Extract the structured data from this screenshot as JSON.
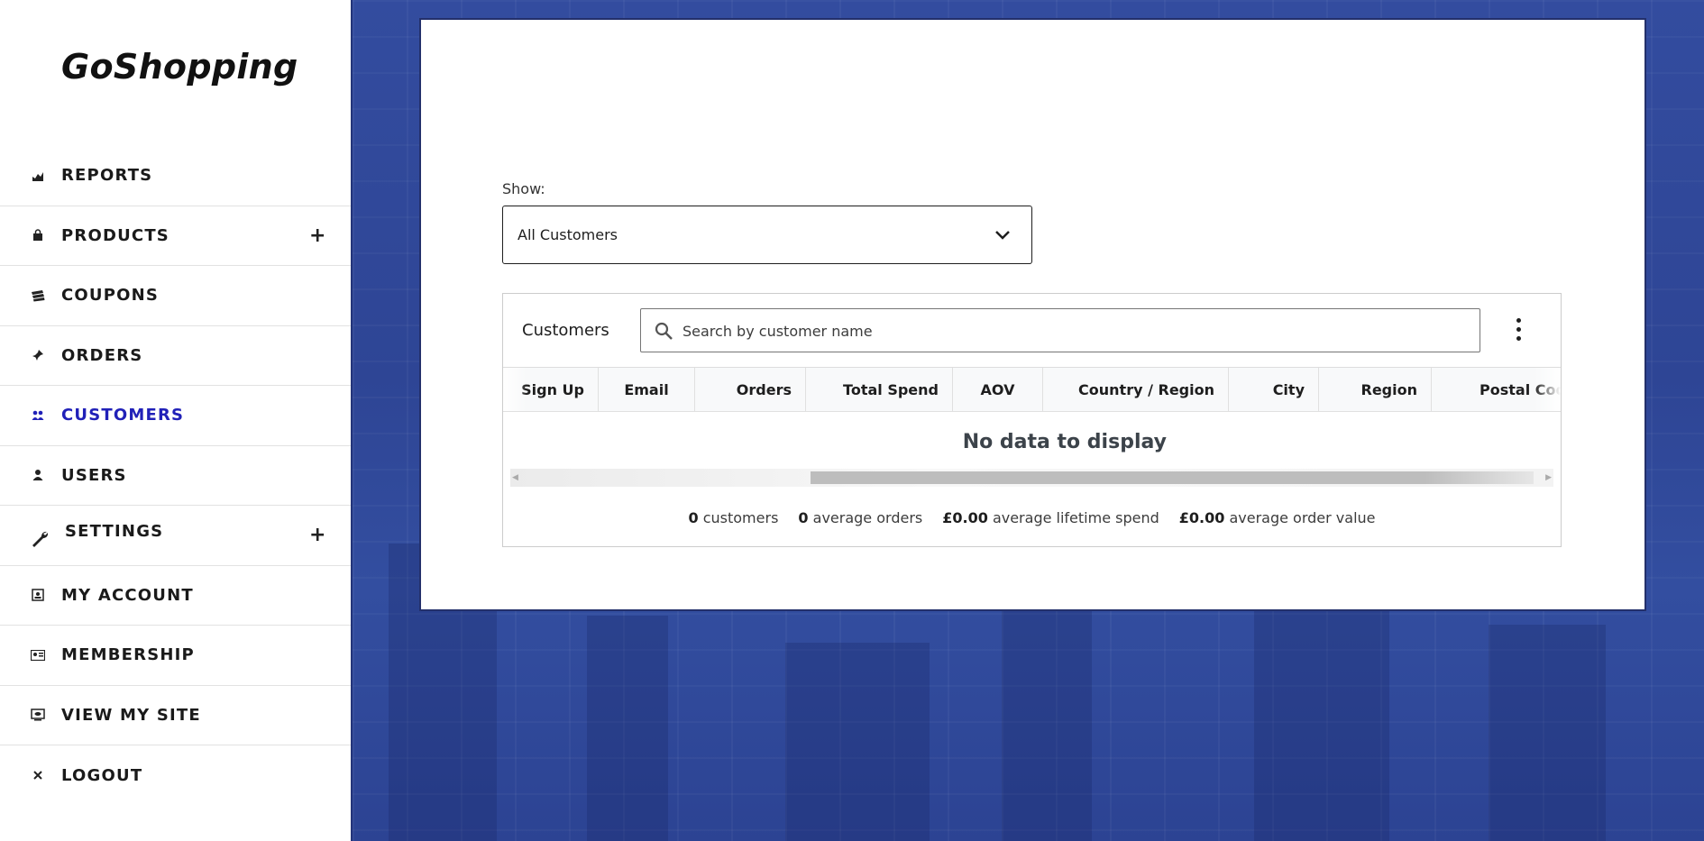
{
  "app": {
    "logo": "GoShopping"
  },
  "sidebar": {
    "items": [
      {
        "label": "REPORTS",
        "icon": "chart-icon",
        "expandable": false,
        "active": false
      },
      {
        "label": "PRODUCTS",
        "icon": "bag-icon",
        "expandable": true,
        "active": false
      },
      {
        "label": "COUPONS",
        "icon": "coupon-icon",
        "expandable": false,
        "active": false
      },
      {
        "label": "ORDERS",
        "icon": "pin-icon",
        "expandable": false,
        "active": false
      },
      {
        "label": "CUSTOMERS",
        "icon": "people-icon",
        "expandable": false,
        "active": true
      },
      {
        "label": "USERS",
        "icon": "user-icon",
        "expandable": false,
        "active": false
      },
      {
        "label": "SETTINGS",
        "icon": "wrench-icon",
        "expandable": true,
        "active": false
      },
      {
        "label": "MY ACCOUNT",
        "icon": "id-card-icon",
        "expandable": false,
        "active": false
      },
      {
        "label": "MEMBERSHIP",
        "icon": "membership-card-icon",
        "expandable": false,
        "active": false
      },
      {
        "label": "VIEW MY SITE",
        "icon": "monitor-icon",
        "expandable": false,
        "active": false
      },
      {
        "label": "LOGOUT",
        "icon": "close-icon",
        "expandable": false,
        "active": false
      }
    ],
    "expand_symbol": "+",
    "active_color": "#2121b8"
  },
  "filter": {
    "label": "Show:",
    "selected": "All Customers"
  },
  "customers_panel": {
    "title": "Customers",
    "search_placeholder": "Search by customer name",
    "columns": [
      "Sign Up",
      "Email",
      "Orders",
      "Total Spend",
      "AOV",
      "Country / Region",
      "City",
      "Region",
      "Postal Cod"
    ],
    "empty_message": "No data to display",
    "summary": [
      {
        "value": "0",
        "label": "customers"
      },
      {
        "value": "0",
        "label": "average orders"
      },
      {
        "value": "£0.00",
        "label": "average lifetime spend"
      },
      {
        "value": "£0.00",
        "label": "average order value"
      }
    ]
  },
  "colors": {
    "background": "#2f4799",
    "card_border": "#23306b"
  }
}
